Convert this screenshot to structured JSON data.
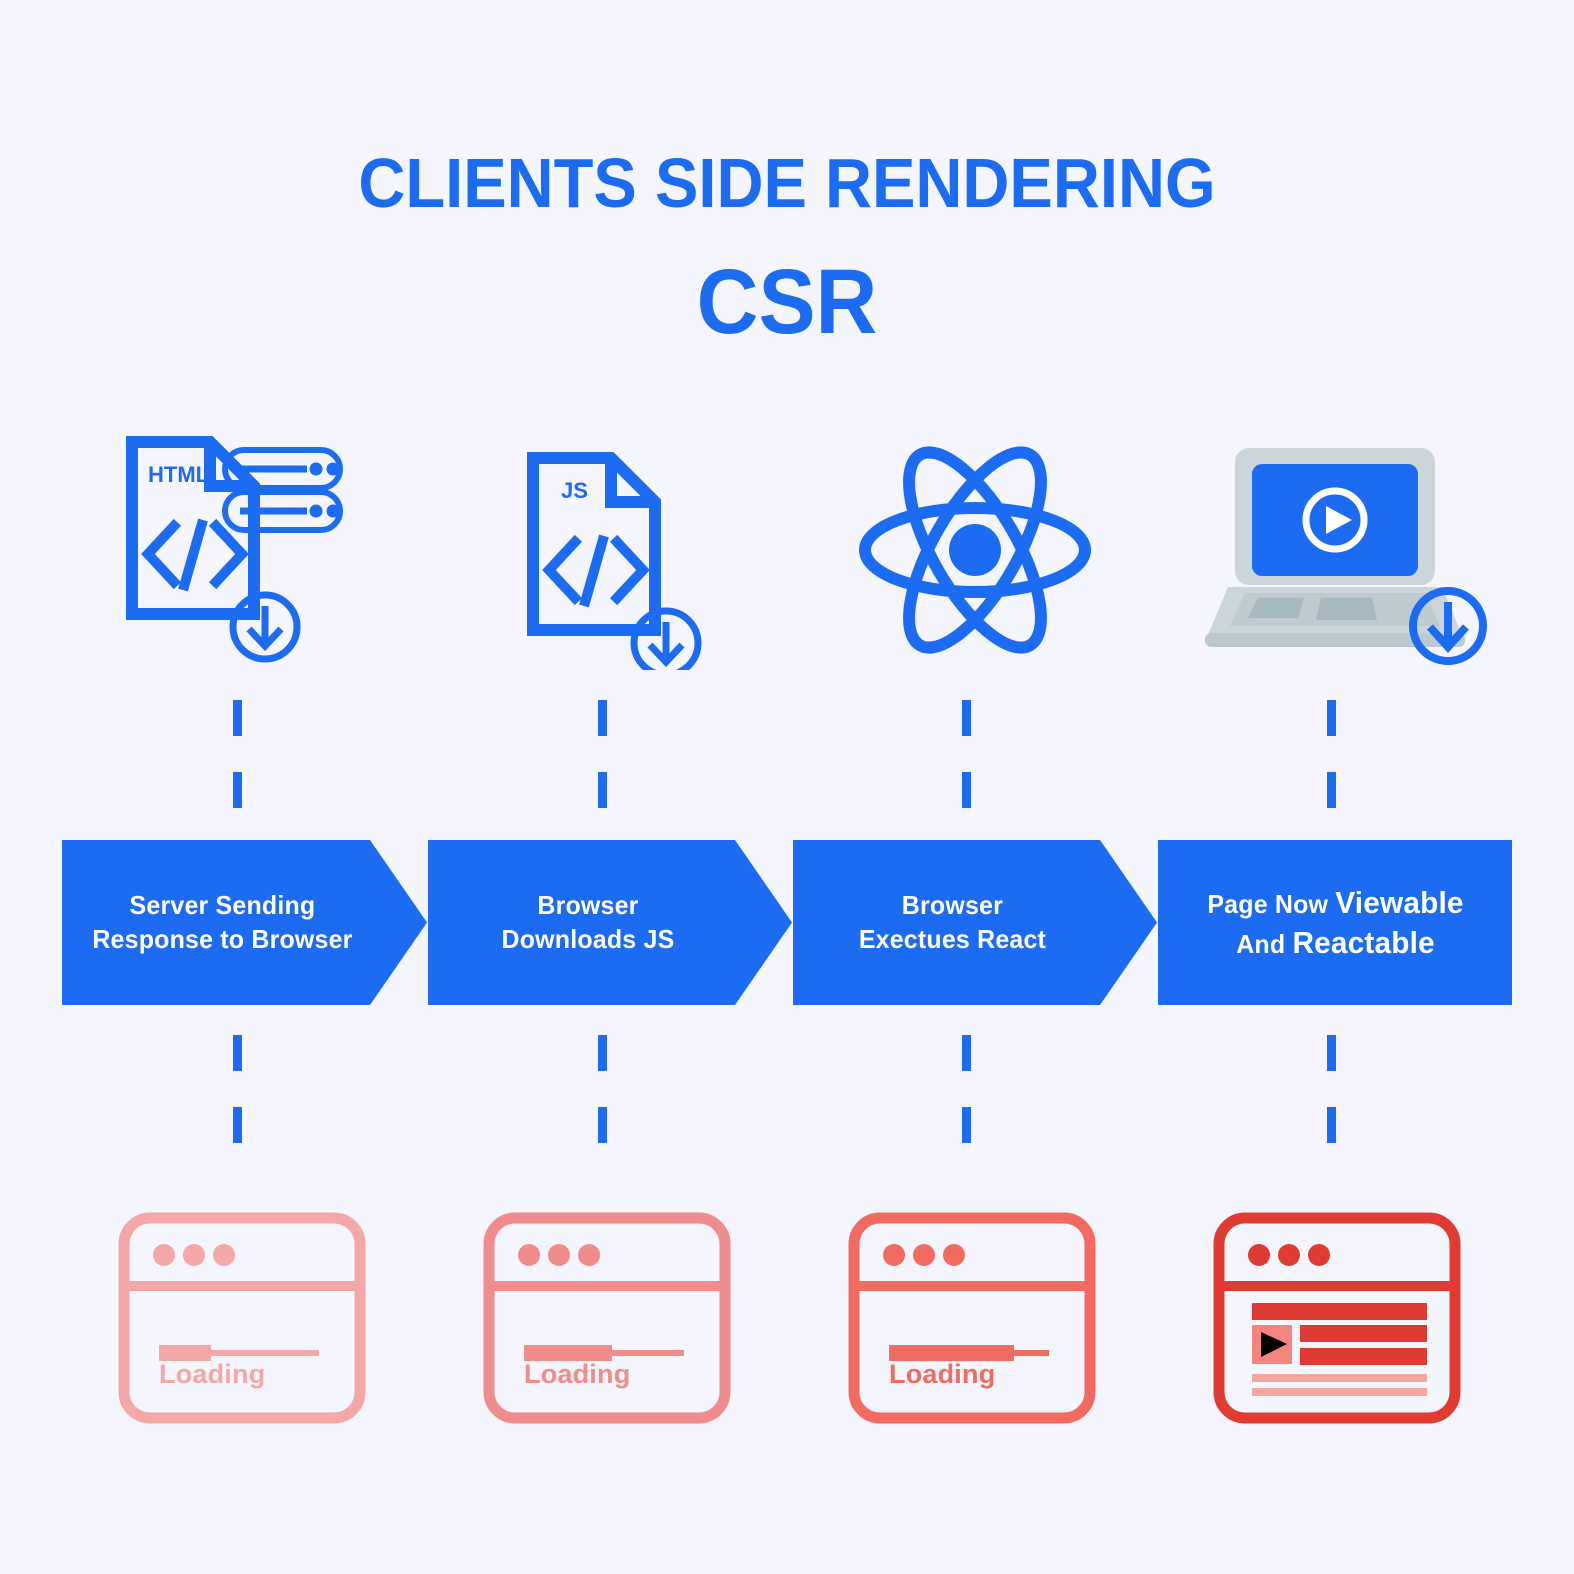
{
  "header": {
    "title": "CLIENTS SIDE RENDERING",
    "subtitle": "CSR"
  },
  "colors": {
    "background": "#f5f5fd",
    "brand_blue": "#1b6cf2",
    "laptop_gray": "#ccd6da",
    "laptop_gray_dark": "#a8b8bf",
    "stage_1_pink": "#f3a7a7",
    "stage_2_pink": "#f08c8c",
    "stage_3_pink": "#f26b61",
    "stage_4_red": "#e03b33",
    "stage_4_pink_light": "#f4847c"
  },
  "stages": [
    {
      "id": "stage-1",
      "icon": "html-file-server-download-icon",
      "icon_label": "HTML",
      "arrow_line1": "Server Sending",
      "arrow_line2": "Response to Browser",
      "arrow_shape": "pointed",
      "browser_state": "loading",
      "browser_label": "Loading",
      "progress_percent": 32,
      "browser_color": "#f3a7a7"
    },
    {
      "id": "stage-2",
      "icon": "js-file-download-icon",
      "icon_label": "JS",
      "arrow_line1": "Browser",
      "arrow_line2": "Downloads JS",
      "arrow_shape": "pointed",
      "browser_state": "loading",
      "browser_label": "Loading",
      "progress_percent": 55,
      "browser_color": "#f08c8c"
    },
    {
      "id": "stage-3",
      "icon": "react-atom-icon",
      "icon_label": "",
      "arrow_line1": "Browser",
      "arrow_line2": "Exectues React",
      "arrow_shape": "pointed",
      "browser_state": "loading",
      "browser_label": "Loading",
      "progress_percent": 78,
      "browser_color": "#f26b61"
    },
    {
      "id": "stage-4",
      "icon": "laptop-play-download-icon",
      "icon_label": "",
      "arrow_line1_prefix": "Page Now ",
      "arrow_line1_strong": "Viewable",
      "arrow_line2_prefix": "And ",
      "arrow_line2_strong": "Reactable",
      "arrow_shape": "flat",
      "browser_state": "loaded",
      "browser_label": "",
      "progress_percent": 100,
      "browser_color": "#e03b33"
    }
  ]
}
